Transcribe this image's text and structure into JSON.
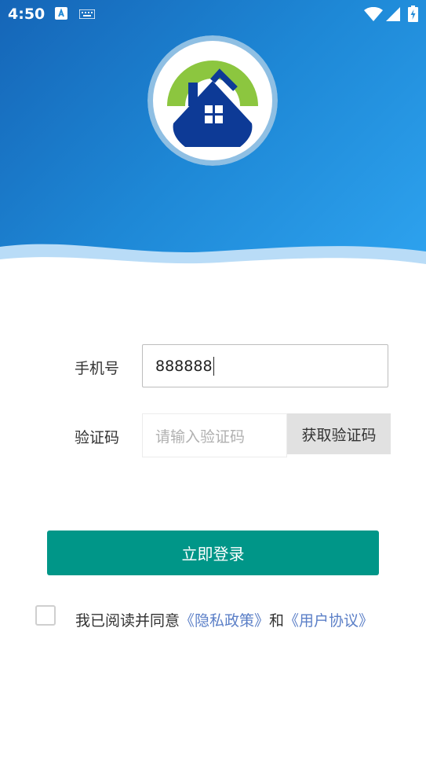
{
  "status_bar": {
    "time": "4:50",
    "icons": [
      "a11y-icon",
      "keyboard-icon",
      "wifi-icon",
      "signal-icon",
      "battery-icon"
    ]
  },
  "colors": {
    "header_start": "#1565b7",
    "header_end": "#2ea3ef",
    "primary_button": "#009688",
    "link": "#5b7fc7",
    "logo_green": "#8cc63f",
    "logo_navy": "#0d3a96"
  },
  "form": {
    "phone_label": "手机号",
    "phone_value": "888888",
    "code_label": "验证码",
    "code_placeholder": "请输入验证码",
    "get_code_button": "获取验证码"
  },
  "login_button": "立即登录",
  "agreement": {
    "checked": false,
    "prefix": "我已阅读并同意",
    "privacy_link": "《隐私政策》",
    "conjunction": "和",
    "terms_link": "《用户协议》"
  }
}
